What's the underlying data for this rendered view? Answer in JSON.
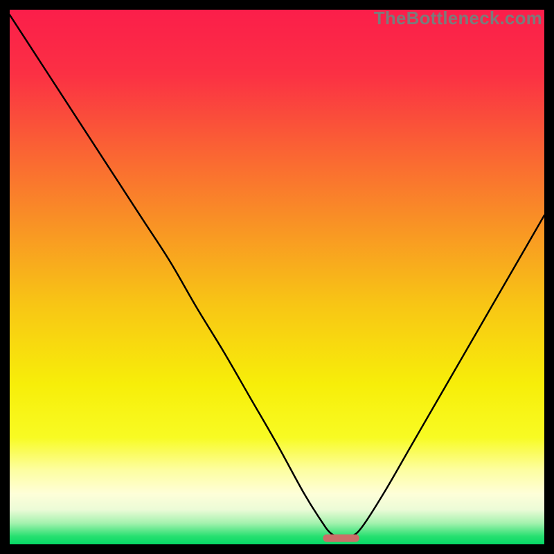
{
  "watermark": "TheBottleneck.com",
  "chart_data": {
    "type": "line",
    "title": "",
    "xlabel": "",
    "ylabel": "",
    "xlim": [
      0,
      100
    ],
    "ylim": [
      0,
      104
    ],
    "series": [
      {
        "name": "bottleneck-curve",
        "x": [
          0,
          5,
          10,
          15,
          20,
          25,
          30,
          35,
          40,
          45,
          50,
          55,
          58,
          60,
          62,
          64,
          66,
          70,
          75,
          80,
          85,
          90,
          95,
          100
        ],
        "y": [
          103,
          95,
          87,
          79,
          71,
          63,
          55,
          46,
          37.5,
          28.5,
          19.5,
          10,
          5,
          2.2,
          1.4,
          1.6,
          3.5,
          10,
          19,
          28,
          37,
          46,
          55,
          64
        ]
      }
    ],
    "optimal_marker": {
      "x_center": 62,
      "x_half_width": 3.4,
      "y": 1.2
    },
    "gradient_stops": [
      {
        "offset": 0.0,
        "color": "#fb1e4a"
      },
      {
        "offset": 0.12,
        "color": "#fb3044"
      },
      {
        "offset": 0.26,
        "color": "#fa6234"
      },
      {
        "offset": 0.4,
        "color": "#f99225"
      },
      {
        "offset": 0.55,
        "color": "#f8c515"
      },
      {
        "offset": 0.7,
        "color": "#f7ee09"
      },
      {
        "offset": 0.8,
        "color": "#f8fb23"
      },
      {
        "offset": 0.86,
        "color": "#fdfe9f"
      },
      {
        "offset": 0.905,
        "color": "#fefed8"
      },
      {
        "offset": 0.935,
        "color": "#ecfbd7"
      },
      {
        "offset": 0.96,
        "color": "#a5f2af"
      },
      {
        "offset": 0.985,
        "color": "#27e070"
      },
      {
        "offset": 1.0,
        "color": "#06d966"
      }
    ],
    "marker_color": "#cb6e68",
    "curve_color": "#000000"
  }
}
